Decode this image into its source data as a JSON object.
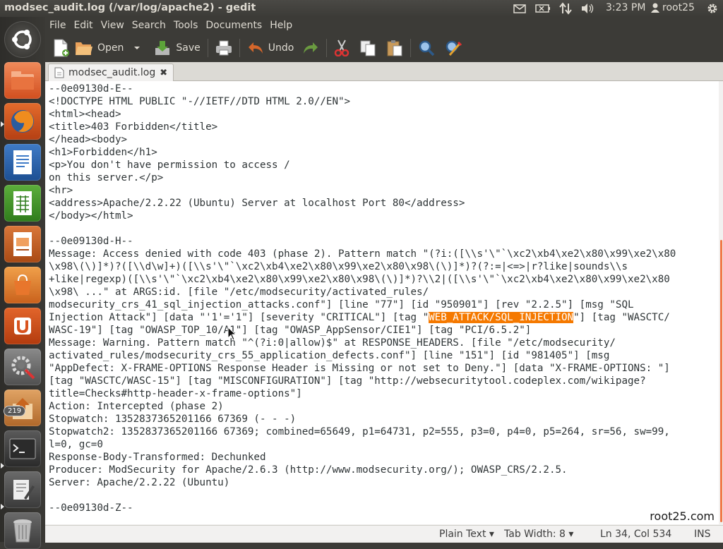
{
  "window_title": "modsec_audit.log (/var/log/apache2) - gedit",
  "top_panel": {
    "clock": "3:23 PM",
    "user": "root25",
    "icons": [
      "mail-icon",
      "battery-icon",
      "network-icon",
      "volume-icon",
      "user-icon",
      "gear-icon"
    ]
  },
  "launcher": {
    "items": [
      "dash-home",
      "files",
      "firefox",
      "libreoffice-writer",
      "libreoffice-calc",
      "libreoffice-impress",
      "ubuntu-software-center",
      "ubuntu-one",
      "system-settings",
      "update-manager",
      "terminal",
      "gedit",
      "trash"
    ],
    "update_badge": "219"
  },
  "menu": [
    "File",
    "Edit",
    "View",
    "Search",
    "Tools",
    "Documents",
    "Help"
  ],
  "toolbar": {
    "open_label": "Open",
    "save_label": "Save",
    "undo_label": "Undo"
  },
  "tab": {
    "label": "modsec_audit.log"
  },
  "editor": {
    "lines": [
      "--0e09130d-E--",
      "<!DOCTYPE HTML PUBLIC \"-//IETF//DTD HTML 2.0//EN\">",
      "<html><head>",
      "<title>403 Forbidden</title>",
      "</head><body>",
      "<h1>Forbidden</h1>",
      "<p>You don't have permission to access /",
      "on this server.</p>",
      "<hr>",
      "<address>Apache/2.2.22 (Ubuntu) Server at localhost Port 80</address>",
      "</body></html>",
      "",
      "--0e09130d-H--",
      "Message: Access denied with code 403 (phase 2). Pattern match \"(?i:([\\\\s'\\\"`\\xc2\\xb4\\xe2\\x80\\x99\\xe2\\x80",
      "\\x98\\(\\)]*)?([\\\\d\\w]+)([\\\\s'\\\"`\\xc2\\xb4\\xe2\\x80\\x99\\xe2\\x80\\x98\\(\\)]*)?(?:=|<=>|r?like|sounds\\\\s",
      "+like|regexp)([\\\\s'\\\"`\\xc2\\xb4\\xe2\\x80\\x99\\xe2\\x80\\x98\\(\\)]*)?\\\\2|([\\\\s'\\\"`\\xc2\\xb4\\xe2\\x80\\x99\\xe2\\x80",
      "\\x98\\ ...\" at ARGS:id. [file \"/etc/modsecurity/activated_rules/",
      "modsecurity_crs_41_sql_injection_attacks.conf\"] [line \"77\"] [id \"950901\"] [rev \"2.2.5\"] [msg \"SQL",
      "Injection Attack\"] [data \"'1'='1\"] [severity \"CRITICAL\"] [tag \"",
      "WASC-19\"] [tag \"OWASP_TOP_10/A1\"] [tag \"OWASP_AppSensor/CIE1\"] [tag \"PCI/6.5.2\"]",
      "Message: Warning. Pattern match \"^(?i:0|allow)$\" at RESPONSE_HEADERS. [file \"/etc/modsecurity/",
      "activated_rules/modsecurity_crs_55_application_defects.conf\"] [line \"151\"] [id \"981405\"] [msg",
      "\"AppDefect: X-FRAME-OPTIONS Response Header is Missing or not set to Deny.\"] [data \"X-FRAME-OPTIONS: \"]",
      "[tag \"WASCTC/WASC-15\"] [tag \"MISCONFIGURATION\"] [tag \"http://websecuritytool.codeplex.com/wikipage?",
      "title=Checks#http-header-x-frame-options\"]",
      "Action: Intercepted (phase 2)",
      "Stopwatch: 1352837365201166 67369 (- - -)",
      "Stopwatch2: 1352837365201166 67369; combined=65649, p1=64731, p2=555, p3=0, p4=0, p5=264, sr=56, sw=99,",
      "l=0, gc=0",
      "Response-Body-Transformed: Dechunked",
      "Producer: ModSecurity for Apache/2.6.3 (http://www.modsecurity.org/); OWASP_CRS/2.2.5.",
      "Server: Apache/2.2.22 (Ubuntu)",
      "",
      "--0e09130d-Z--"
    ],
    "highlight_line_index": 18,
    "highlight_text": "WEB_ATTACK/SQL_INJECTION",
    "highlight_suffix": "\"] [tag \"WASCTC/",
    "highlight_color": "#f57900",
    "watermark": "root25.com"
  },
  "statusbar": {
    "language": "Plain Text",
    "tab_width": "Tab Width: 8",
    "position": "Ln 34, Col 534",
    "mode": "INS"
  }
}
